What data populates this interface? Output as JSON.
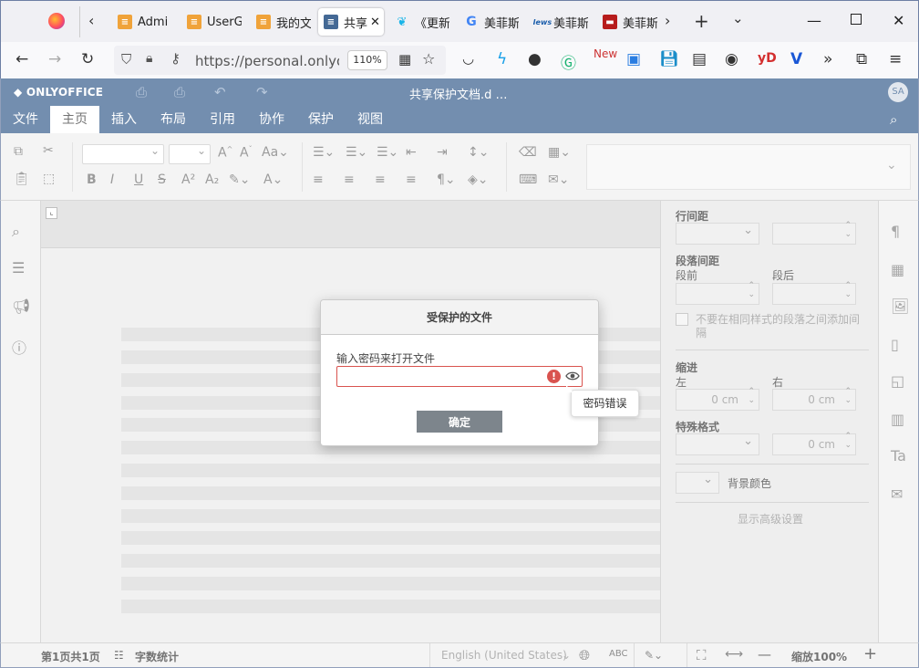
{
  "browser": {
    "tabs": [
      {
        "label": "Admi",
        "icon": "stack-icon",
        "color": "#f0a33a"
      },
      {
        "label": "UserG",
        "icon": "stack-icon",
        "color": "#f0a33a"
      },
      {
        "label": "我的文",
        "icon": "stack-icon",
        "color": "#f0a33a"
      },
      {
        "label": "共享",
        "icon": "document-icon",
        "color": "#446995"
      },
      {
        "label": "《更新",
        "icon": "bird-icon",
        "color": "#19b5e8"
      },
      {
        "label": "美菲斯",
        "icon": "google-icon",
        "color": "#4285f4"
      },
      {
        "label": "美菲斯",
        "icon": "news-icon",
        "color": "#1a5dab"
      },
      {
        "label": "美菲斯",
        "icon": "red-icon",
        "color": "#b71c1c"
      }
    ],
    "url": "https://personal.onlyoffi",
    "zoom_badge": "110%"
  },
  "oo": {
    "logo": "ONLYOFFICE",
    "doc_title": "共享保护文档.d …",
    "avatar": "SA",
    "menu": [
      "文件",
      "主页",
      "插入",
      "布局",
      "引用",
      "协作",
      "保护",
      "视图"
    ],
    "active_menu": "主页"
  },
  "panel": {
    "line_spacing": "行间距",
    "para_spacing": "段落间距",
    "before": "段前",
    "after": "段后",
    "no_space": "不要在相同样式的段落之间添加间隔",
    "indent": "缩进",
    "left": "左",
    "right": "右",
    "left_val": "0 cm",
    "right_val": "0 cm",
    "special": "特殊格式",
    "special_val": "0 cm",
    "bgcolor": "背景颜色",
    "advanced": "显示高级设置"
  },
  "status": {
    "page": "第1页共1页",
    "wordcount": "字数统计",
    "language": "English (United States)",
    "zoom": "缩放100%"
  },
  "dialog": {
    "title": "受保护的文件",
    "label": "输入密码来打开文件",
    "ok": "确定",
    "error_tip": "密码错误",
    "password_value": ""
  },
  "colors": {
    "header": "#446995",
    "error": "#d9534f",
    "button": "#7d858c"
  }
}
